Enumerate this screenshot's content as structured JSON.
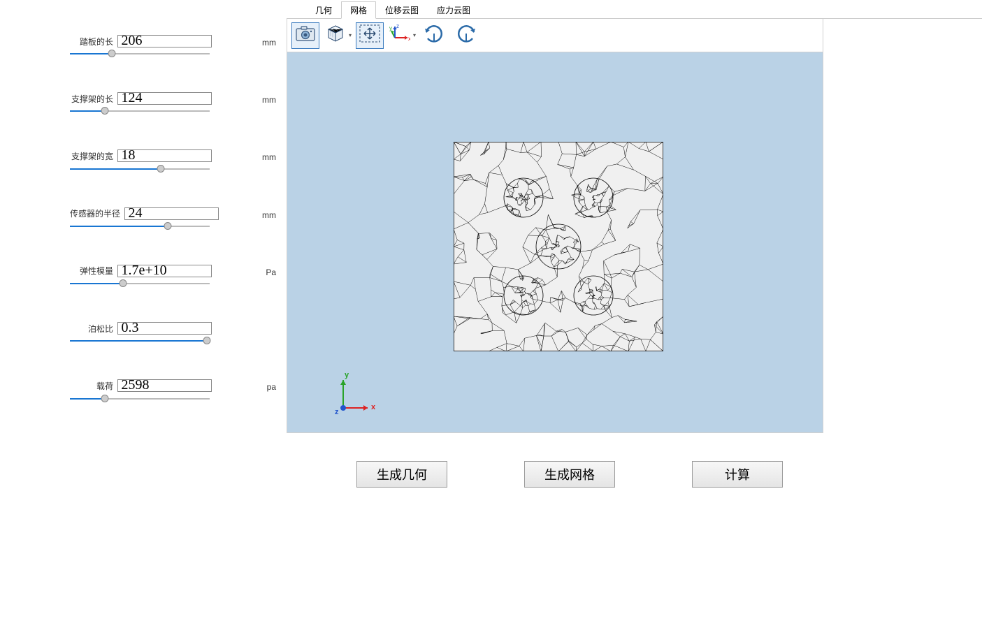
{
  "params": [
    {
      "label": "踏板的长",
      "value": "206",
      "unit": "mm",
      "fill": 30
    },
    {
      "label": "支撑架的长",
      "value": "124",
      "unit": "mm",
      "fill": 25
    },
    {
      "label": "支撑架的宽",
      "value": "18",
      "unit": "mm",
      "fill": 65
    },
    {
      "label": "传感器的半径",
      "value": "24",
      "unit": "mm",
      "fill": 70
    },
    {
      "label": "弹性模量",
      "value": "1.7e+10",
      "unit": "Pa",
      "fill": 38
    },
    {
      "label": "泊松比",
      "value": "0.3",
      "unit": "",
      "fill": 98
    },
    {
      "label": "载荷",
      "value": "2598",
      "unit": "pa",
      "fill": 25
    }
  ],
  "tabs": [
    {
      "label": "几何",
      "active": false
    },
    {
      "label": "网格",
      "active": true
    },
    {
      "label": "位移云图",
      "active": false
    },
    {
      "label": "应力云图",
      "active": false
    }
  ],
  "axes": {
    "x": "x",
    "y": "y",
    "z": "z"
  },
  "buttons": {
    "gen_geometry": "生成几何",
    "gen_mesh": "生成网格",
    "compute": "计算"
  }
}
